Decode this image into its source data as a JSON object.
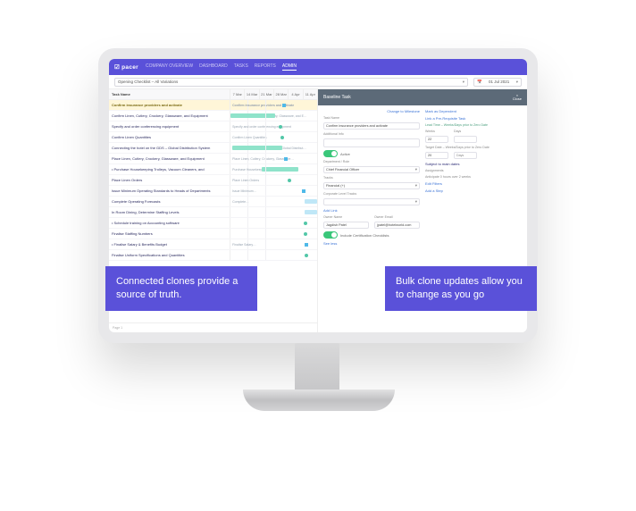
{
  "brand": "pacer",
  "nav": {
    "items": [
      "COMPANY OVERVIEW",
      "DASHBOARD",
      "TASKS",
      "REPORTS",
      "ADMIN"
    ],
    "active": "ADMIN"
  },
  "filter": {
    "variation": "Opening Checklist – All Variations",
    "date": "01 Jul 2021"
  },
  "gantt": {
    "name_header": "Task Name",
    "cols": [
      "7 Mar",
      "14 Mar",
      "21 Mar",
      "28 Mar",
      "4 Apr",
      "11 Apr"
    ],
    "rows": [
      {
        "name": "Confirm insurance providers and activate",
        "hl": true,
        "label2": "Confirm insurance providers and activate",
        "sq": 60
      },
      {
        "name": "Confirm Linen, Cutlery, Crockery, Glassware, and Equipment",
        "label2": "Confirm Linen, Cutlery, Crockery, Glassware, and E…",
        "bar": [
          0,
          52
        ]
      },
      {
        "name": "Specify and order conferencing equipment",
        "label2": "Specify and order conferencing equipment",
        "dot": 56
      },
      {
        "name": "Confirm Linen Quantities",
        "label2": "Confirm Linen Quantities",
        "dot": 58
      },
      {
        "name": "Connecting the hotel on the GDS – Global Distribution System",
        "label2": "Connecting the hotel on the GDS – Global Distribut…",
        "bar": [
          2,
          60
        ]
      },
      {
        "name": "Place Linen, Cutlery, Crockery, Glassware, and Equipment",
        "label2": "Place Linen, Cutlery, Crockery, Glassware…",
        "sq": 62
      },
      {
        "name": "• Purchase Housekeeping Trolleys, Vacuum Cleaners, and",
        "label2": "Purchase Housekeeping Trolleys, Vacuum…",
        "bar": [
          36,
          78
        ]
      },
      {
        "name": "Place Linen Orders",
        "label2": "Place Linen Orders",
        "dot": 66
      },
      {
        "name": "Issue Minimum Operating Standards to Heads of Departments",
        "label2": "Issue Minimum…",
        "sq": 82
      },
      {
        "name": "Complete Operating Forecasts",
        "label2": "Complete…",
        "barB": [
          86,
          100
        ]
      },
      {
        "name": "In Room Dining, Determine Staffing Levels",
        "label2": "",
        "barB": [
          86,
          100
        ]
      },
      {
        "name": "• Schedule training on Accounting software",
        "label2": "",
        "dot": 85
      },
      {
        "name": "Finalise Staffing Numbers",
        "label2": "",
        "dot": 85
      },
      {
        "name": "• Finalise Salary & Benefits Budget",
        "label2": "Finalise Salary…",
        "sq": 86
      },
      {
        "name": "Finalise Uniform Specifications and Quantities",
        "label2": "",
        "dot": 86
      }
    ],
    "footer": "Page 1"
  },
  "detail": {
    "title": "Baseline Task",
    "close": "Close",
    "change_milestone": "Change to Milestone",
    "mark_dependent": "Mark as Dependent",
    "task_name_label": "Task Name",
    "task_name_value": "Confirm insurance providers and activate",
    "link_prereq": "Link a Pre-Requisite Task",
    "lead_time_label": "Lead Time – Weeks/Days prior to Zero Date",
    "weeks_label": "Weeks",
    "weeks_val": "22",
    "days_label": "Days",
    "days_ph": "",
    "target_date_label": "Target Date – Weeks/Days prior to Zero Date",
    "tweeks_val": "20",
    "tdays_ph": "Days",
    "additional_info": "Additional Info",
    "active": "Active",
    "dept_label": "Department / Role",
    "dept_value": "Chief Financial Officer",
    "tracks_label": "Tracks",
    "tracks_value": "Financial (+)",
    "corp_label": "Corporate Level Tracks",
    "corp_ph": "",
    "subject_main": "Subject to main dates",
    "assign_label": "Assignments",
    "assign_note": "Anticipate 0 hours over 2 weeks",
    "edit_filters": "Edit Filters",
    "add_step": "Add a Step",
    "add_link": "Add Link",
    "owner_label": "Owner Name",
    "owner_value": "Jagdish Patel",
    "owner_email_label": "Owner Email",
    "owner_email_value": "jpatel@hotelworld.com",
    "include_cert": "Include Certification Checklists",
    "see_less": "See less"
  },
  "callouts": {
    "left": "Connected clones provide a source of truth.",
    "right": "Bulk clone updates allow you to change as you go"
  }
}
